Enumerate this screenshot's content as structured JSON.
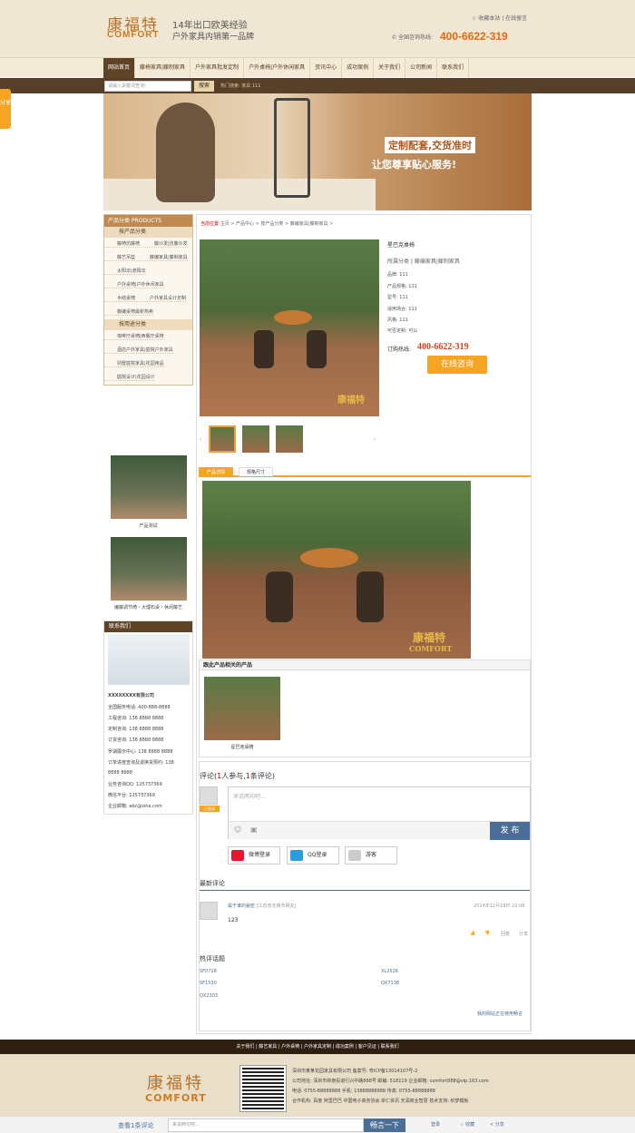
{
  "header": {
    "logo_cn": "康福特",
    "logo_en": "COMFORT",
    "slogan1": "14年出口欧美经验",
    "slogan2": "户外家具内销第一品牌",
    "toplinks": "☆ 收藏本站 | 在线留言",
    "hotline_label": "全国咨询热线:",
    "hotline": "400-6622-319"
  },
  "nav": [
    "网站首页",
    "藤椅家具|藤制家具",
    "户外家具批发定制",
    "户外桌椅|户外休闲家具",
    "资讯中心",
    "成功案例",
    "关于我们",
    "公司新闻",
    "联系我们"
  ],
  "search": {
    "placeholder": "请输入关键词查询!",
    "button": "搜索",
    "hot": "热门搜索: 家具 111"
  },
  "side_tab": "分享",
  "banner": {
    "line1": "定制配套,交货准时",
    "line2": "让您尊享贴心服务!"
  },
  "left": {
    "cat_title": "产品分类 PRODUCTS",
    "sub1": "按产品分类",
    "items1": [
      "藤椅仿藤椅",
      "藤沙发|仿藤沙发",
      "藤艺吊篮",
      "藤编家具|藤制家具",
      "太阳伞|遮阳伞",
      "户外桌椅|户外休闲家具",
      "木结桌椅",
      "户外家具设计定制",
      "藤编桌椅最新热卖"
    ],
    "sub2": "按用途分类",
    "items2": [
      "咖啡厅桌椅|西餐厅桌椅",
      "酒店户外家具|庭院户外家具",
      "别墅庭院家具|花园用品",
      "庭院设计|花园设计"
    ],
    "prod1": "产品测试",
    "prod2": "编藤调节椅・大理石桌・休闲藤艺",
    "contact_title": "联系我们",
    "company": "XXXXXXXX有限公司",
    "lines": [
      "全国服务电话: 400-888-8888",
      "工程咨询: 138 8888 8888",
      "定制咨询: 138 8888 8888",
      "订货咨询: 138 8888 8888",
      "罗湖展示中心: 138 8888 8888",
      "订单进度查询及退换货预约: 138",
      "8888 8888",
      "业务咨询QQ: 125737369",
      "微信平台: 125737369",
      "企业邮箱: abc@sina.com"
    ]
  },
  "product": {
    "crumb_label": "当前位置:",
    "crumb": "主页 > 产品中心 > 按产品分类 > 藤编家具|藤制家具 >",
    "name": "星巴克桌椅",
    "category": "所属分类 | 藤编家具|藤制家具",
    "attrs": [
      "品牌: 111",
      "产品规格: 111",
      "型号: 111",
      "适用场合: 111",
      "风格: 111",
      "可否定制: 可以"
    ],
    "order_label": "订购热线:",
    "order_num": "400-6622-319",
    "consult": "在线咨询",
    "tabs": [
      "产品详情",
      "规格尺寸"
    ],
    "watermark_cn": "康福特",
    "watermark_en": "COMFORT",
    "related_title": "跟此产品相关的产品",
    "related_cap": "星巴克桌椅"
  },
  "comment": {
    "head_pre": "评论(",
    "head_n1": "1",
    "head_mid": "人参与,",
    "head_n2": "1",
    "head_post": "条评论)",
    "placeholder": "来说两句吧...",
    "publish": "发 布",
    "avatar_tag": "已登录",
    "logins": [
      "微博登录",
      "QQ登录",
      "游客"
    ],
    "latest_title": "最新评论",
    "user": "属于谁的秘密",
    "loc": "[江苏省无锡市网友]",
    "date": "2014年12月18日 22:08",
    "text": "123",
    "actions": [
      "👍",
      "👎",
      "回复",
      "分享"
    ],
    "hot_title": "热评话题",
    "hot": [
      "SF0718",
      "XL2526",
      "SF1530",
      "QX7138",
      "QX2303"
    ],
    "powered": "我的网站正在使用畅言"
  },
  "footer": {
    "nav": "关于我们 | 藤艺家具 | 户外桌椅 | 户外家具定制 | 成功案例 | 客户见证 | 联系我们",
    "logo_cn": "康福特",
    "logo_en": "COMFORT",
    "lines": [
      "深圳市某某花园家具有限公司 备案号: 粤ICP备13014107号-2",
      "公司地址: 深圳市新南投道行兴中路888号  邮编: 518119  企业邮箱: comfort888@vip.163.com",
      "电话: 0755-88888888  手机: 13888888888  传真: 0755-88888888",
      "合作机构: 百度 阿里巴巴 中国电子商务协会 单仁资讯 天润商业智慧 技术支持: 织梦模板"
    ]
  },
  "bottombar": {
    "label": "查看1条评论",
    "placeholder": "来说两句吧...",
    "button": "畅言一下",
    "actions": [
      "登录",
      "☆ 收藏",
      "< 分享"
    ]
  }
}
